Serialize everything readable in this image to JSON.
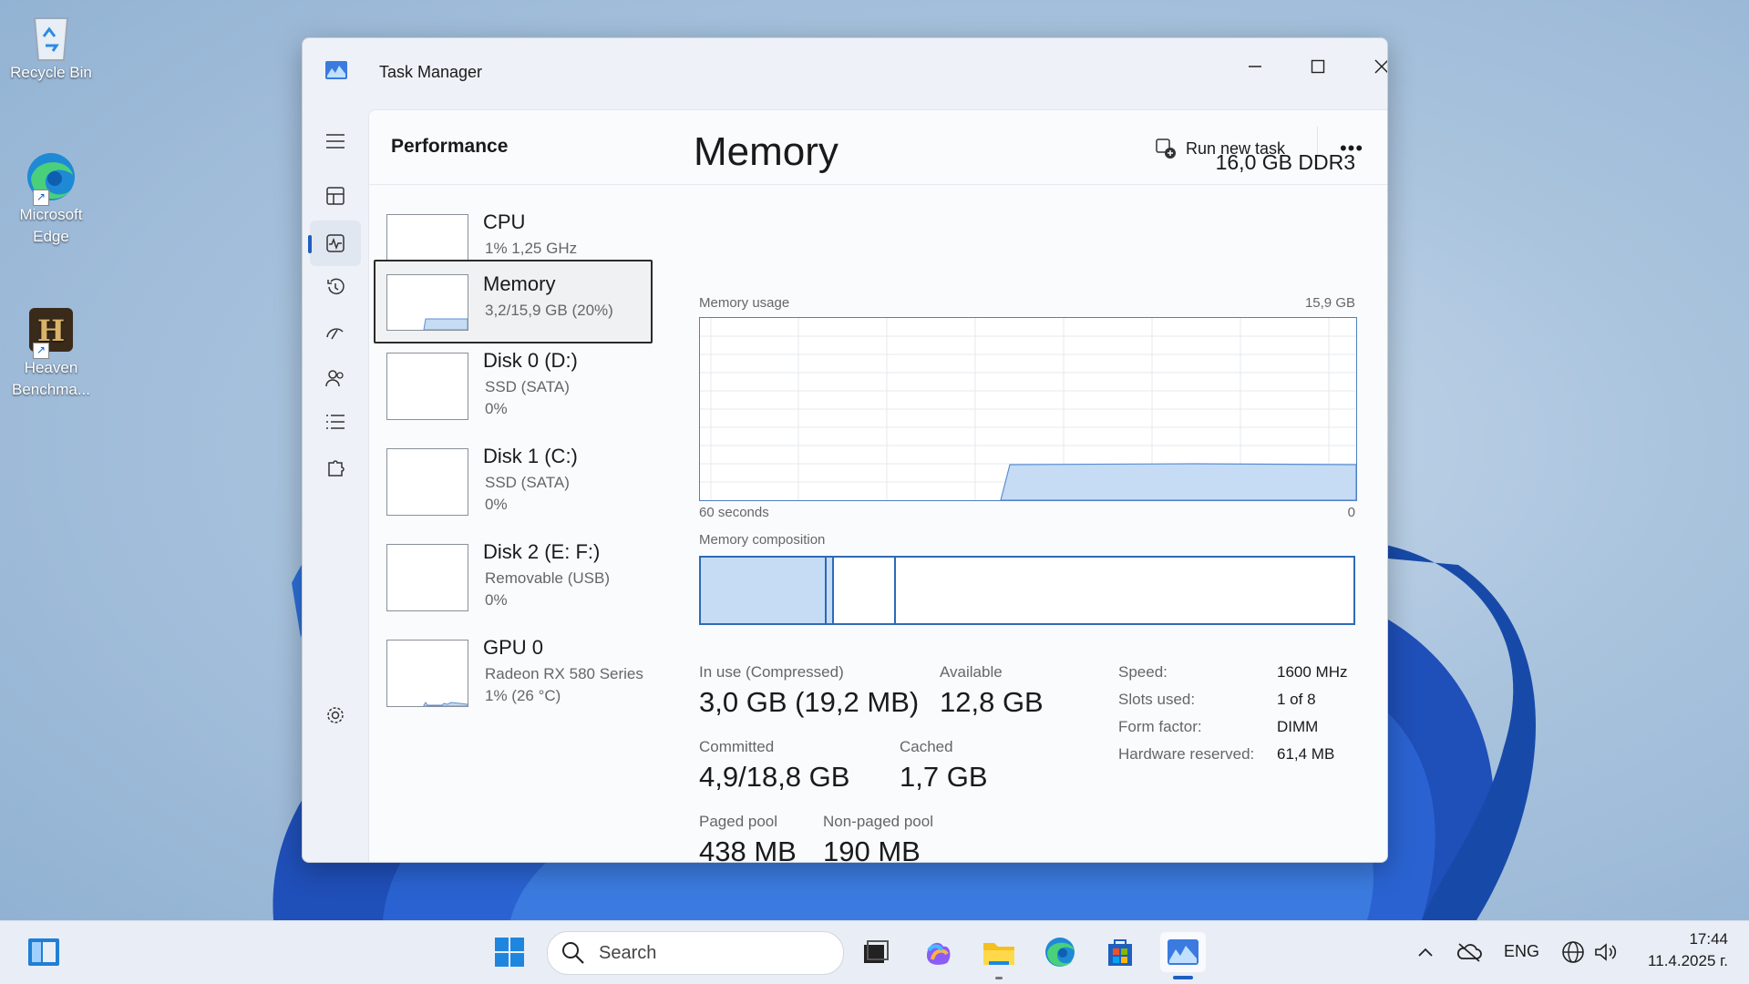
{
  "desktop": {
    "icons": [
      {
        "label": "Recycle Bin",
        "icon": "recycle-bin-icon"
      },
      {
        "label": "Microsoft Edge",
        "icon": "edge-icon"
      },
      {
        "label": "Heaven Benchma...",
        "icon": "heaven-benchmark-icon"
      }
    ]
  },
  "window": {
    "title": "Task Manager",
    "page_title": "Performance",
    "run_new_task": "Run new task",
    "more": "•••"
  },
  "devices": [
    {
      "name": "CPU",
      "line1": "1% 1,25 GHz",
      "line2": ""
    },
    {
      "name": "Memory",
      "line1": "3,2/15,9 GB (20%)",
      "line2": ""
    },
    {
      "name": "Disk 0 (D:)",
      "line1": "SSD (SATA)",
      "line2": "0%"
    },
    {
      "name": "Disk 1 (C:)",
      "line1": "SSD (SATA)",
      "line2": "0%"
    },
    {
      "name": "Disk 2 (E: F:)",
      "line1": "Removable (USB)",
      "line2": "0%"
    },
    {
      "name": "GPU 0",
      "line1": "Radeon RX 580 Series",
      "line2": "1% (26 °C)"
    }
  ],
  "detail": {
    "title": "Memory",
    "spec": "16,0 GB DDR3",
    "usage_label": "Memory usage",
    "usage_max": "15,9 GB",
    "time_left": "60 seconds",
    "time_right": "0",
    "composition_label": "Memory composition",
    "stats": {
      "in_use_label": "In use (Compressed)",
      "in_use_value": "3,0 GB (19,2 MB)",
      "available_label": "Available",
      "available_value": "12,8 GB",
      "committed_label": "Committed",
      "committed_value": "4,9/18,8 GB",
      "cached_label": "Cached",
      "cached_value": "1,7 GB",
      "paged_label": "Paged pool",
      "paged_value": "438 MB",
      "nonpaged_label": "Non-paged pool",
      "nonpaged_value": "190 MB"
    },
    "specs": [
      {
        "label": "Speed:",
        "value": "1600 MHz"
      },
      {
        "label": "Slots used:",
        "value": "1 of 8"
      },
      {
        "label": "Form factor:",
        "value": "DIMM"
      },
      {
        "label": "Hardware reserved:",
        "value": "61,4 MB"
      }
    ]
  },
  "taskbar": {
    "search_placeholder": "Search",
    "language": "ENG",
    "time": "17:44",
    "date": "11.4.2025 г."
  },
  "colors": {
    "accent": "#1f5fbf",
    "graph_fill": "#c5dcf4",
    "graph_line": "#5b8fd6"
  }
}
